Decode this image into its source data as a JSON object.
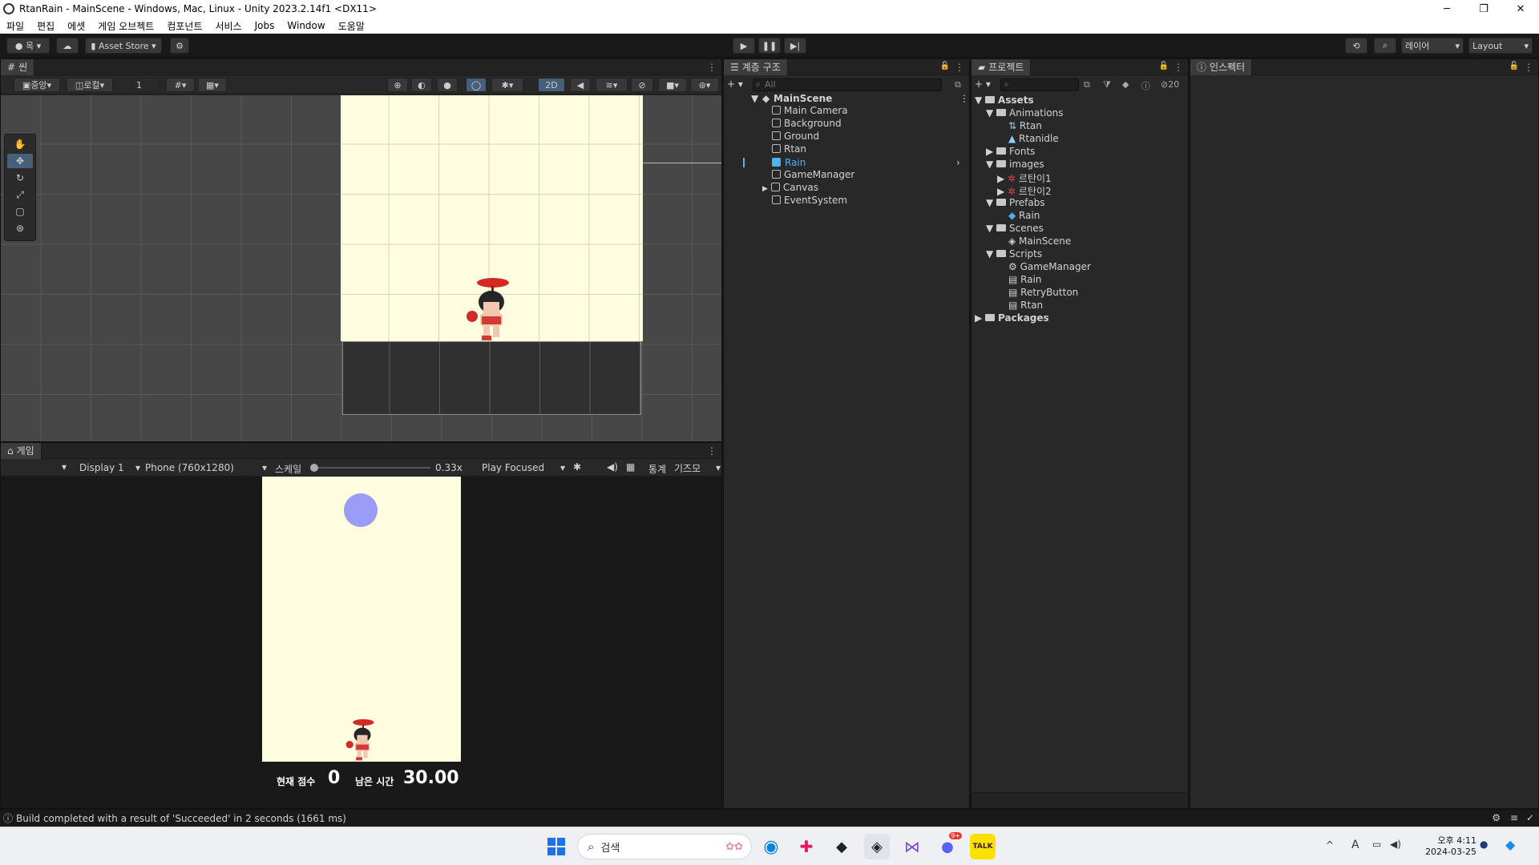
{
  "window": {
    "title": "RtanRain - MainScene - Windows, Mac, Linux - Unity 2023.2.14f1 <DX11>",
    "minimize": "─",
    "maximize": "❐",
    "close": "✕"
  },
  "menu": [
    "파일",
    "편집",
    "에셋",
    "게임 오브젝트",
    "컴포넌트",
    "서비스",
    "Jobs",
    "Window",
    "도움말"
  ],
  "toolbar": {
    "account": "옥",
    "asset_store": "Asset Store",
    "layers": "레이어",
    "layout": "Layout"
  },
  "scene": {
    "tab": "씬",
    "pivot": "중앙",
    "space": "로컬",
    "grid_snap_value": "1",
    "mode_2d": "2D"
  },
  "game": {
    "tab": "게임",
    "display": "Display 1",
    "resolution": "Phone (760x1280)",
    "scale_label": "스케일",
    "scale_value": "0.33x",
    "play_mode": "Play Focused",
    "stats": "통계",
    "gizmos": "기즈모",
    "hud": {
      "score_label": "현재 점수",
      "score_value": "0",
      "time_label": "남은 시간",
      "time_value": "30.00"
    }
  },
  "hierarchy": {
    "tab": "계층 구조",
    "search_placeholder": "All",
    "scene_name": "MainScene",
    "items": [
      "Main Camera",
      "Background",
      "Ground",
      "Rtan",
      "Rain",
      "GameManager",
      "Canvas",
      "EventSystem"
    ],
    "selected": "Rain"
  },
  "project": {
    "tab": "프로젝트",
    "hidden_count": "20",
    "tree": {
      "assets": "Assets",
      "animations": "Animations",
      "anim_rtan": "Rtan",
      "anim_rtanidle": "Rtanidle",
      "fonts": "Fonts",
      "images": "images",
      "img1": "르탄이1",
      "img2": "르탄이2",
      "prefabs": "Prefabs",
      "prefab_rain": "Rain",
      "scenes": "Scenes",
      "scene_main": "MainScene",
      "scripts": "Scripts",
      "script_gm": "GameManager",
      "script_rain": "Rain",
      "script_retry": "RetryButton",
      "script_rtan": "Rtan",
      "packages": "Packages"
    }
  },
  "inspector": {
    "tab": "인스펙터"
  },
  "status": {
    "message": "Build completed with a result of 'Succeeded' in 2 seconds (1661 ms)"
  },
  "taskbar": {
    "search_placeholder": "검색",
    "time": "오후 4:11",
    "date": "2024-03-25",
    "discord_badge": "9+",
    "kakao_label": "TALK"
  },
  "colors": {
    "sky": "#fffde0",
    "rain": "#9a9cf7",
    "selection": "#4cb3f0",
    "panel": "#282828"
  }
}
